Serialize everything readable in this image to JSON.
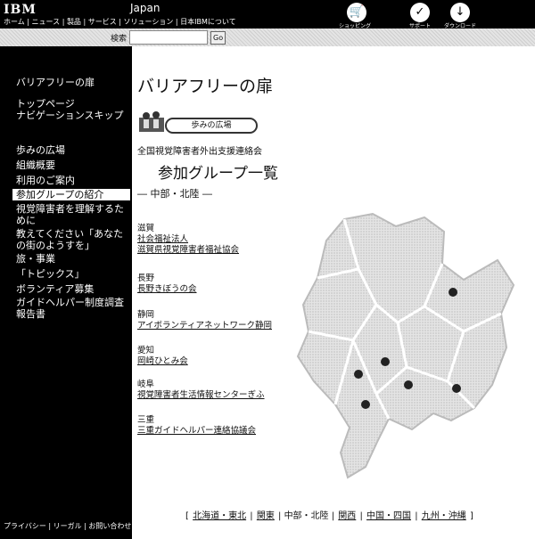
{
  "header": {
    "logo": "IBM",
    "country": "Japan",
    "nav": [
      "ホーム",
      "ニュース",
      "製品",
      "サービス",
      "ソリューション",
      "日本IBMについて"
    ],
    "tools": [
      {
        "label": "ショッピング",
        "icon": "cart-icon"
      },
      {
        "label": "サポート",
        "icon": "check-icon"
      },
      {
        "label": "ダウンロード",
        "icon": "download-icon"
      }
    ]
  },
  "search": {
    "label": "検索",
    "value": "",
    "button": "Go"
  },
  "sidebar": {
    "title": "バリアフリーの扉",
    "items": [
      {
        "label": "トップページ"
      },
      {
        "label": "ナビゲーションスキップ"
      },
      {
        "label": "歩みの広場"
      },
      {
        "label": "組織概要"
      },
      {
        "label": "利用のご案内"
      },
      {
        "label": "参加グループの紹介",
        "active": true
      },
      {
        "label": "視覚障害者を理解するために"
      },
      {
        "label": "教えてください「あなたの街のようすを」"
      },
      {
        "label": "旅・事業"
      },
      {
        "label": "「トピックス」"
      },
      {
        "label": "ボランティア募集"
      },
      {
        "label": "ガイドヘルパー制度調査報告書"
      }
    ],
    "footer": "プライバシー | リーガル | お問い合わせ"
  },
  "main": {
    "title": "バリアフリーの扉",
    "badge": "歩みの広場",
    "org": "全国視覚障害者外出支援連絡会",
    "list_title": "参加グループ一覧",
    "region": "― 中部・北陸 ―",
    "groups": [
      {
        "pref": "滋賀",
        "links": [
          "社会福祉法人",
          "滋賀県視覚障害者福祉協会"
        ]
      },
      {
        "pref": "長野",
        "links": [
          "長野きぼうの会"
        ]
      },
      {
        "pref": "静岡",
        "links": [
          "アイボランティアネットワーク静岡"
        ]
      },
      {
        "pref": "愛知",
        "links": [
          "岡崎ひとみ会"
        ]
      },
      {
        "pref": "岐阜",
        "links": [
          "視覚障害者生活情報センターぎふ"
        ]
      },
      {
        "pref": "三重",
        "links": [
          "三重ガイドヘルパー連絡協議会"
        ]
      }
    ]
  },
  "bottom_nav": {
    "open": "[",
    "close": "]",
    "items": [
      "北海道・東北",
      "関東",
      "中部・北陸",
      "関西",
      "中国・四国",
      "九州・沖縄"
    ]
  }
}
